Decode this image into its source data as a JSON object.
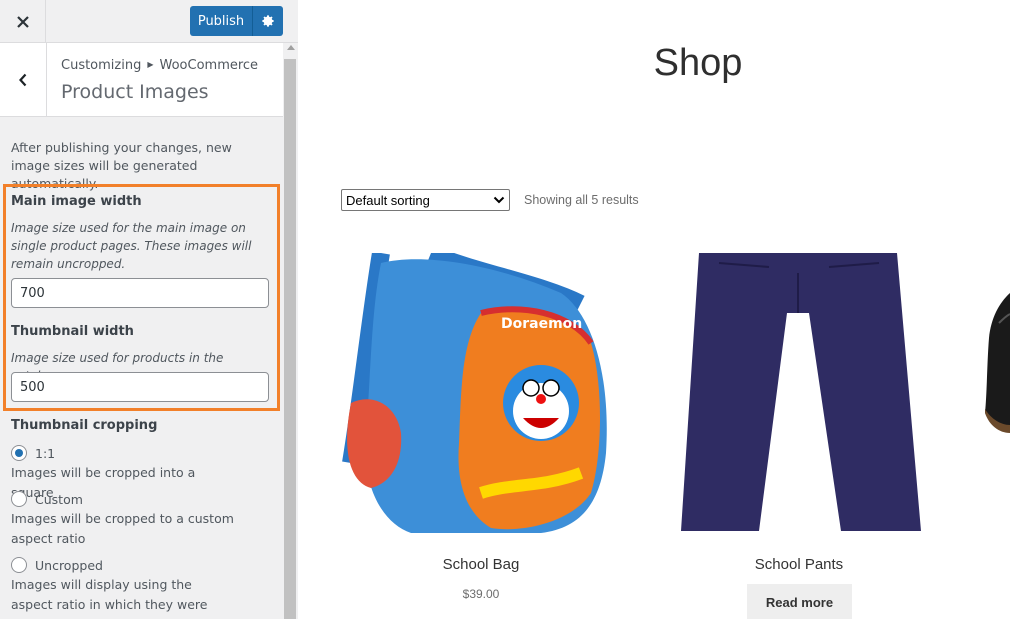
{
  "topbar": {
    "close_icon": "close-icon",
    "publish_label": "Publish",
    "settings_icon": "gear-icon",
    "accent": "#2271b1"
  },
  "section": {
    "breadcrumb_root": "Customizing",
    "breadcrumb_sep_icon": "triangle-right-icon",
    "breadcrumb_parent": "WooCommerce",
    "title": "Product Images"
  },
  "panel": {
    "notice": "After publishing your changes, new image sizes will be generated automatically.",
    "highlight_color": "#f2802a",
    "main_width": {
      "label": "Main image width",
      "description": "Image size used for the main image on single product pages. These images will remain uncropped.",
      "value": "700"
    },
    "thumb_width": {
      "label": "Thumbnail width",
      "description": "Image size used for products in the catalog.",
      "value": "500"
    },
    "cropping": {
      "label": "Thumbnail cropping",
      "options": [
        {
          "label": "1:1",
          "description": "Images will be cropped into a square",
          "checked": true
        },
        {
          "label": "Custom",
          "description": "Images will be cropped to a custom aspect ratio",
          "checked": false
        },
        {
          "label": "Uncropped",
          "description": "Images will display using the aspect ratio in which they were uploaded",
          "checked": false
        }
      ]
    }
  },
  "preview": {
    "title": "Shop",
    "sorting": {
      "selected": "Default sorting"
    },
    "results_text": "Showing all 5 results",
    "products": [
      {
        "name": "School Bag",
        "price": "$39.00"
      },
      {
        "name": "School Pants",
        "button": "Read more"
      }
    ]
  }
}
